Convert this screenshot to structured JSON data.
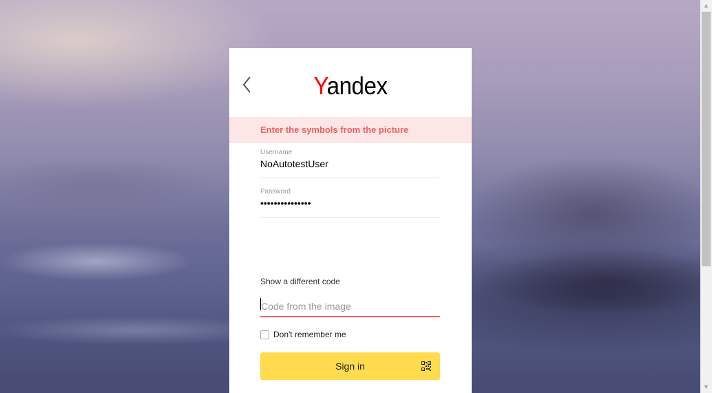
{
  "card": {
    "logo_first": "Y",
    "logo_rest": "andex",
    "error": "Enter the symbols from the picture",
    "username": {
      "label": "Username",
      "value": "NoAutotestUser"
    },
    "password": {
      "label": "Password",
      "value": "•••••••••••••••"
    },
    "different_code": "Show a different code",
    "code_input": {
      "placeholder": "Code from the image",
      "value": ""
    },
    "remember_label": "Don't remember me",
    "signin_label": "Sign in"
  },
  "colors": {
    "accent_yellow": "#ffdb4d",
    "error_red": "#f25e5e",
    "logo_red": "#ff0000"
  },
  "icons": {
    "back": "chevron-left-icon",
    "qr": "qr-code-icon"
  }
}
